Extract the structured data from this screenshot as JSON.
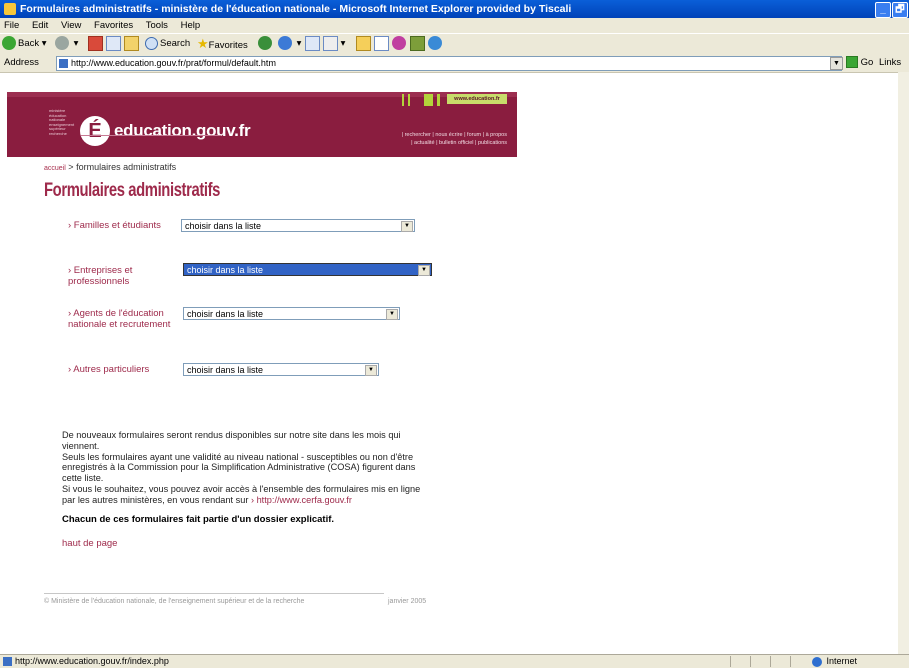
{
  "window": {
    "title": "Formulaires administratifs - ministère de l'éducation nationale - Microsoft Internet Explorer provided by Tiscali",
    "minimize": "_",
    "restore": "🗗"
  },
  "menu": [
    "File",
    "Edit",
    "View",
    "Favorites",
    "Tools",
    "Help"
  ],
  "toolbar": {
    "back": "Back",
    "search": "Search",
    "favorites": "Favorites"
  },
  "address": {
    "label": "Address",
    "url": "http://www.education.gouv.fr/prat/formul/default.htm",
    "go": "Go",
    "links": "Links"
  },
  "banner": {
    "ministry_lines": [
      "ministère",
      "éducation",
      "nationale",
      "enseignement",
      "supérieur",
      "recherche"
    ],
    "logo_letter": "É",
    "site_name": "education.gouv.fr",
    "tag": "www.education.fr",
    "links_row1": "| rechercher  |  nous écrire  |  forum  |  à propos",
    "links_row2": "|  actualité  |  bulletin officiel  |  publications"
  },
  "breadcrumb": {
    "home": "accueil",
    "sep": " > ",
    "current": "formulaires administratifs"
  },
  "page_title": "Formulaires administratifs",
  "categories": [
    {
      "label": "› Familles et étudiants",
      "select": "choisir dans la liste"
    },
    {
      "label": "› Entreprises et professionnels",
      "select": "choisir dans la liste"
    },
    {
      "label": "› Agents de l'éducation nationale et recrutement",
      "select": "choisir dans la liste"
    },
    {
      "label": "› Autres particuliers",
      "select": "choisir dans la liste"
    }
  ],
  "info": {
    "p1": "De nouveaux formulaires seront rendus disponibles sur notre site dans les mois qui viennent.",
    "p2": "Seuls les formulaires ayant une validité au niveau national - susceptibles ou non d'être enregistrés à la Commission pour la Simplification Administrative (COSA) figurent dans cette liste.",
    "p3": "Si vous le souhaitez, vous pouvez avoir accès à l'ensemble des formulaires mis en ligne par les autres ministères, en vous rendant sur ",
    "p3_link": "› http://www.cerfa.gouv.fr",
    "bold": "Chacun de ces formulaires fait partie d'un dossier explicatif.",
    "top_link": "haut de page"
  },
  "footer": {
    "copyright": "© Ministère de l'éducation nationale, de l'enseignement supérieur et de la recherche",
    "date": "janvier 2005"
  },
  "status": {
    "url": "http://www.education.gouv.fr/index.php",
    "zone": "Internet"
  }
}
